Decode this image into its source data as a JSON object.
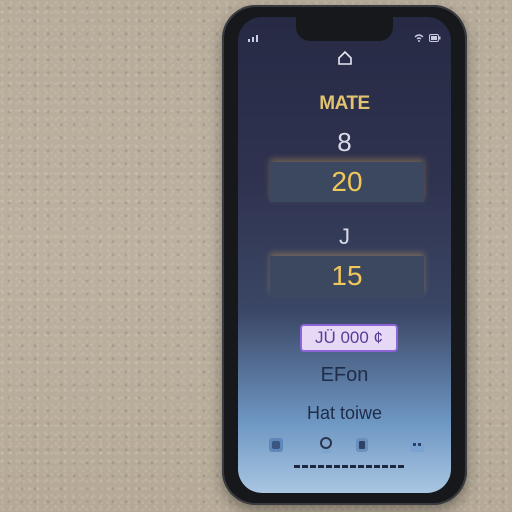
{
  "screen": {
    "title": "MATE",
    "value_top": "8",
    "box_1": "20",
    "value_mid": "J",
    "box_2": "15",
    "badge": "JÜ 000 ¢",
    "word_1": "EFon",
    "word_2": "Hat toiwe"
  },
  "icons": {
    "home": "home-icon",
    "dock": [
      "phone-icon",
      "contacts-icon",
      "messages-icon",
      "apps-icon"
    ]
  },
  "colors": {
    "accent": "#f0c85a",
    "badge_border": "#8e63d8",
    "screen_top": "#272a44",
    "screen_bottom": "#a9c6e2"
  }
}
